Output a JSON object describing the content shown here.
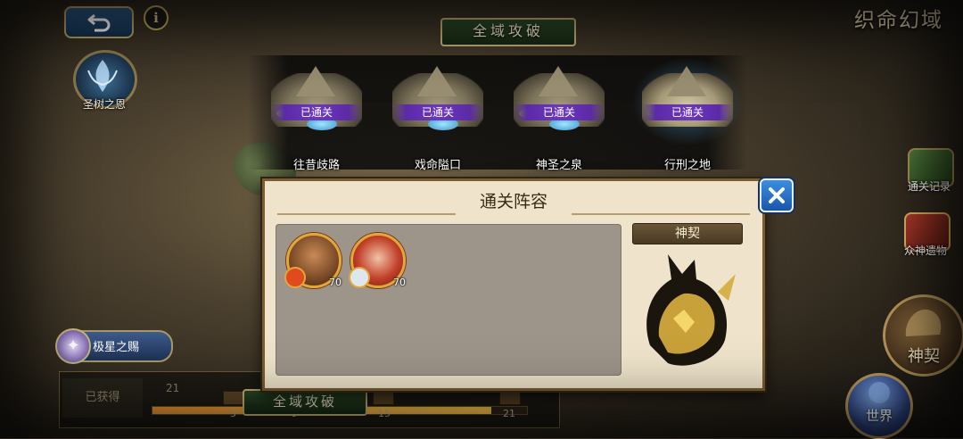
{
  "header": {
    "realm_title": "织命幻域",
    "info_glyph": "i",
    "back_icon": "back-arrow-icon"
  },
  "sidebar_left": {
    "sacred_tree_label": "圣树之恩"
  },
  "stages_banner": {
    "title": "全域攻破",
    "stages": [
      {
        "name": "往昔歧路",
        "status": "已通关"
      },
      {
        "name": "戏命隘口",
        "status": "已通关"
      },
      {
        "name": "神圣之泉",
        "status": "已通关"
      },
      {
        "name": "行刑之地",
        "status": "已通关"
      }
    ],
    "background_label": "戏命隘口"
  },
  "right_menu": {
    "clear_record": "通关记录",
    "gods_relics": "众神遗物",
    "divine_pact": "神契",
    "world": "世界"
  },
  "bottom": {
    "star_gift": "极星之赐",
    "obtained": "已获得",
    "plaque": "全域攻破",
    "milestones": [
      "3",
      "6",
      "15",
      "21"
    ],
    "top_counter": "21",
    "progress": 0.9
  },
  "dialog": {
    "title": "通关阵容",
    "pact_label": "神契",
    "heroes": [
      {
        "level": "70",
        "element_color": "#e04a1f"
      },
      {
        "level": "70",
        "element_color": "#dde7ee"
      }
    ]
  },
  "colors": {
    "accent_gold": "#c7b27a",
    "cleared_ribbon": "#6d38c0",
    "close_button": "#1a56a8"
  }
}
